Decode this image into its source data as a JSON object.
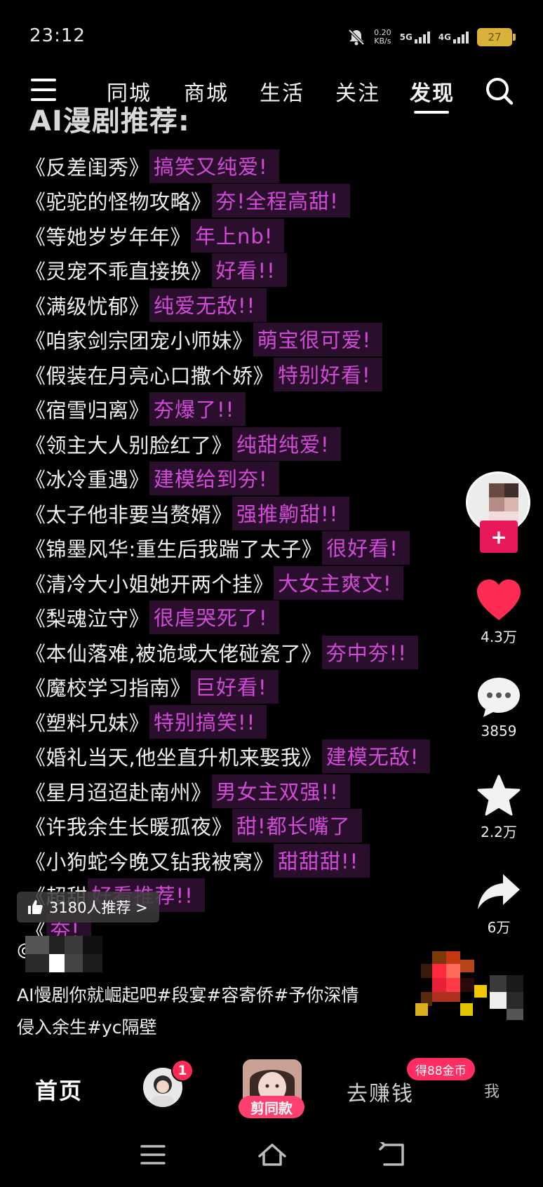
{
  "status_bar": {
    "time": "23:12",
    "net_speed_value": "0.20",
    "net_speed_unit": "KB/s",
    "signal1": "5G",
    "signal2": "4G",
    "battery": "27"
  },
  "top_nav": {
    "tabs": [
      {
        "label": "同城",
        "active": false
      },
      {
        "label": "商城",
        "active": false
      },
      {
        "label": "生活",
        "active": false
      },
      {
        "label": "关注",
        "active": false
      },
      {
        "label": "发现",
        "active": true
      }
    ]
  },
  "video": {
    "heading": "AI漫剧推荐:",
    "items": [
      {
        "title": "《反差闺秀》",
        "comment": "搞笑又纯爱!"
      },
      {
        "title": "《驼驼的怪物攻略》",
        "comment": "夯!全程高甜!"
      },
      {
        "title": "《等她岁岁年年》",
        "comment": "年上nb!"
      },
      {
        "title": "《灵宠不乖直接换》",
        "comment": "好看!!"
      },
      {
        "title": "《满级忧郁》",
        "comment": "纯爱无敌!!"
      },
      {
        "title": "《咱家剑宗团宠小师妹》",
        "comment": "萌宝很可爱!"
      },
      {
        "title": "《假装在月亮心口撒个娇》",
        "comment": "特别好看!"
      },
      {
        "title": "《宿雪归离》",
        "comment": "夯爆了!!"
      },
      {
        "title": "《领主大人别脸红了》",
        "comment": "纯甜纯爱!"
      },
      {
        "title": "《冰冷重遇》",
        "comment": "建模给到夯!"
      },
      {
        "title": "《太子他非要当赘婿》",
        "comment": "强推齁甜!!"
      },
      {
        "title": "《锦墨风华:重生后我踹了太子》",
        "comment": "很好看!"
      },
      {
        "title": "《清冷大小姐她开两个挂》",
        "comment": "大女主爽文!"
      },
      {
        "title": "《梨魂泣守》",
        "comment": "很虐哭死了!"
      },
      {
        "title": "《本仙落难,被诡域大佬碰瓷了》",
        "comment": "夯中夯!!"
      },
      {
        "title": "《魔校学习指南》",
        "comment": "巨好看!"
      },
      {
        "title": "《塑料兄妹》",
        "comment": "特别搞笑!!"
      },
      {
        "title": "《婚礼当天,他坐直升机来娶我》",
        "comment": "建模无敌!"
      },
      {
        "title": "《星月迢迢赴南州》",
        "comment": "男女主双强!!"
      },
      {
        "title": "《许我余生长暖孤夜》",
        "comment": "甜!都长嘴了"
      },
      {
        "title": "《小狗蛇今晚又钻我被窝》",
        "comment": "甜甜甜!!"
      },
      {
        "title": "《超甜",
        "comment": "好看推荐!!"
      },
      {
        "title": "《",
        "comment": "夯!"
      }
    ],
    "recommend_chip": "3180人推荐 >",
    "author_prefix": "@",
    "caption": "AI慢剧你就崛起吧#段宴#容寄侨#予你深情侵入余生#yc隔壁"
  },
  "right_rail": {
    "follow_label": "+",
    "like_count": "4.3万",
    "comment_count": "3859",
    "favorite_count": "2.2万",
    "share_count": "6万"
  },
  "bottom_nav": {
    "home": "首页",
    "badge": "1",
    "center_label": "剪同款",
    "earn": "去赚钱",
    "coin_badge": "得88金币",
    "me": "我"
  },
  "colors": {
    "accent_pink": "#ff2b55",
    "comment_purple": "#d24ad8",
    "comment_bg": "#2a0f2c",
    "like_red": "#fe2c55"
  }
}
